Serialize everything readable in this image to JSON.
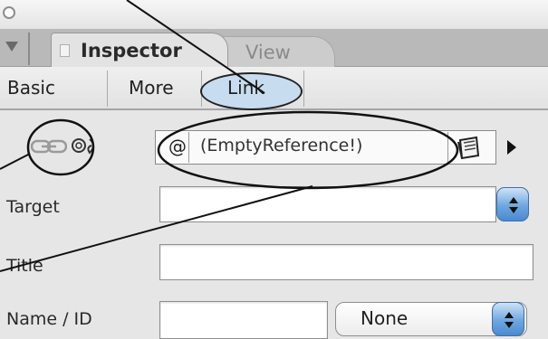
{
  "inspector": {
    "tabs": [
      {
        "label": "Inspector"
      },
      {
        "label": "View"
      }
    ],
    "subtabs": [
      {
        "label": "Basic"
      },
      {
        "label": "More"
      },
      {
        "label": "Link"
      }
    ],
    "reference": {
      "icon": "reference-icon",
      "value": "(EmptyReference!)"
    },
    "fields": {
      "target_label": "Target",
      "title_label": "Title",
      "nameid_label": "Name / ID",
      "nameid_popup_value": "None"
    }
  },
  "icons": {
    "collapse": "disclosure-triangle-icon",
    "link": "link-chain-icon",
    "target": "target-anchor-icon",
    "browse": "folder-browse-icon",
    "arrow": "arrow-right-icon"
  },
  "colors": {
    "link_highlight": "#c8dcf0",
    "stepper_blue": "#6ea6e0",
    "panel_bg": "#e6e6e6"
  }
}
